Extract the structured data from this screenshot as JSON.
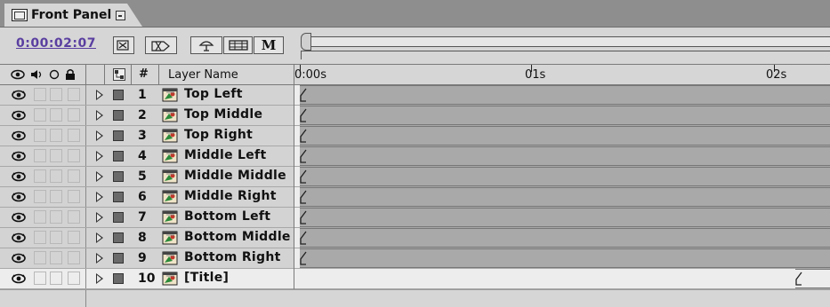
{
  "window": {
    "tab_title": "Front Panel",
    "tab_icon": "composition-icon"
  },
  "toolbar": {
    "timecode": "0:00:02:07",
    "buttons": [
      {
        "name": "draft-3d-button",
        "icon": "draft-3d-icon"
      },
      {
        "name": "wireframe-button",
        "icon": "wireframe-icon"
      },
      {
        "name": "shy-button",
        "icon": "shy-icon"
      },
      {
        "name": "frame-blend-button",
        "icon": "frame-blend-icon"
      },
      {
        "name": "motion-blur-button",
        "label": "M"
      }
    ]
  },
  "header": {
    "switch_icons": [
      "eye-icon",
      "speaker-icon",
      "solo-icon",
      "lock-icon"
    ],
    "number_label": "#",
    "name_label": "Layer Name",
    "ruler": [
      {
        "label": "0:00s"
      },
      {
        "label": "01s"
      },
      {
        "label": "02s"
      }
    ]
  },
  "layers": [
    {
      "number": "1",
      "name": "Top Left",
      "selected": false,
      "start": 0.0
    },
    {
      "number": "2",
      "name": "Top Middle",
      "selected": false,
      "start": 0.0
    },
    {
      "number": "3",
      "name": "Top Right",
      "selected": false,
      "start": 0.0
    },
    {
      "number": "4",
      "name": "Middle Left",
      "selected": false,
      "start": 0.0
    },
    {
      "number": "5",
      "name": "Middle Middle",
      "selected": false,
      "start": 0.0
    },
    {
      "number": "6",
      "name": "Middle Right",
      "selected": false,
      "start": 0.0
    },
    {
      "number": "7",
      "name": "Bottom Left",
      "selected": false,
      "start": 0.0
    },
    {
      "number": "8",
      "name": "Bottom Middle",
      "selected": false,
      "start": 0.0
    },
    {
      "number": "9",
      "name": "Bottom Right",
      "selected": false,
      "start": 0.0
    },
    {
      "number": "10",
      "name": "[Title]",
      "selected": true,
      "start": 2.1
    }
  ]
}
